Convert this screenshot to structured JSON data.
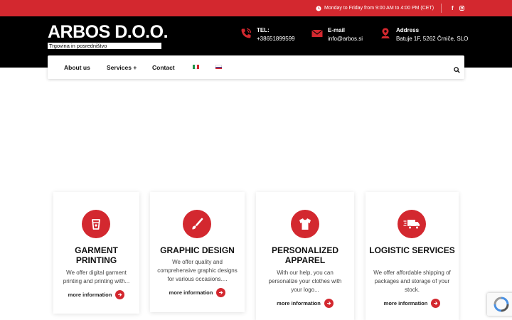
{
  "topbar": {
    "hours": "Monday to Friday from 9:00 AM to 4:00 PM (CET)",
    "social": [
      "facebook-icon",
      "instagram-icon"
    ]
  },
  "header": {
    "logo": {
      "main": "ARBOS D.O.O.",
      "sub": "Trgovina in posredništvo"
    },
    "contacts": [
      {
        "label": "TEL:",
        "value": "+38651899599",
        "icon": "phone-icon"
      },
      {
        "label": "E-mail",
        "value": "info@arbos.si",
        "icon": "envelope-icon"
      },
      {
        "label": "Address",
        "value": "Batuje 1F, 5262 Črniče, SLO",
        "icon": "map-pin-icon"
      }
    ]
  },
  "nav": {
    "items": [
      "About us",
      "Services +",
      "Contact"
    ],
    "flags": [
      "italian-flag",
      "slovenian-flag"
    ],
    "search_icon": "search-icon"
  },
  "cards": [
    {
      "title": "GARMENT PRINTING",
      "desc": "We offer digital garment printing and printing with...",
      "more": "more information",
      "icon": "cup-icon"
    },
    {
      "title": "GRAPHIC DESIGN",
      "desc": "We offer quality and comprehensive graphic designs for various occasions....",
      "more": "more information",
      "icon": "paintbrush-icon"
    },
    {
      "title": "PERSONALIZED APPAREL",
      "desc": "With our help, you can personalize your clothes with your logo...",
      "more": "more information",
      "icon": "tshirt-icon"
    },
    {
      "title": "LOGISTIC SERVICES",
      "desc": "We offer affordable shipping of packages and storage of your stock.",
      "more": "more information",
      "icon": "truck-icon"
    }
  ],
  "colors": {
    "accent": "#d3282f",
    "header": "#000000",
    "background": "#ffffff"
  }
}
